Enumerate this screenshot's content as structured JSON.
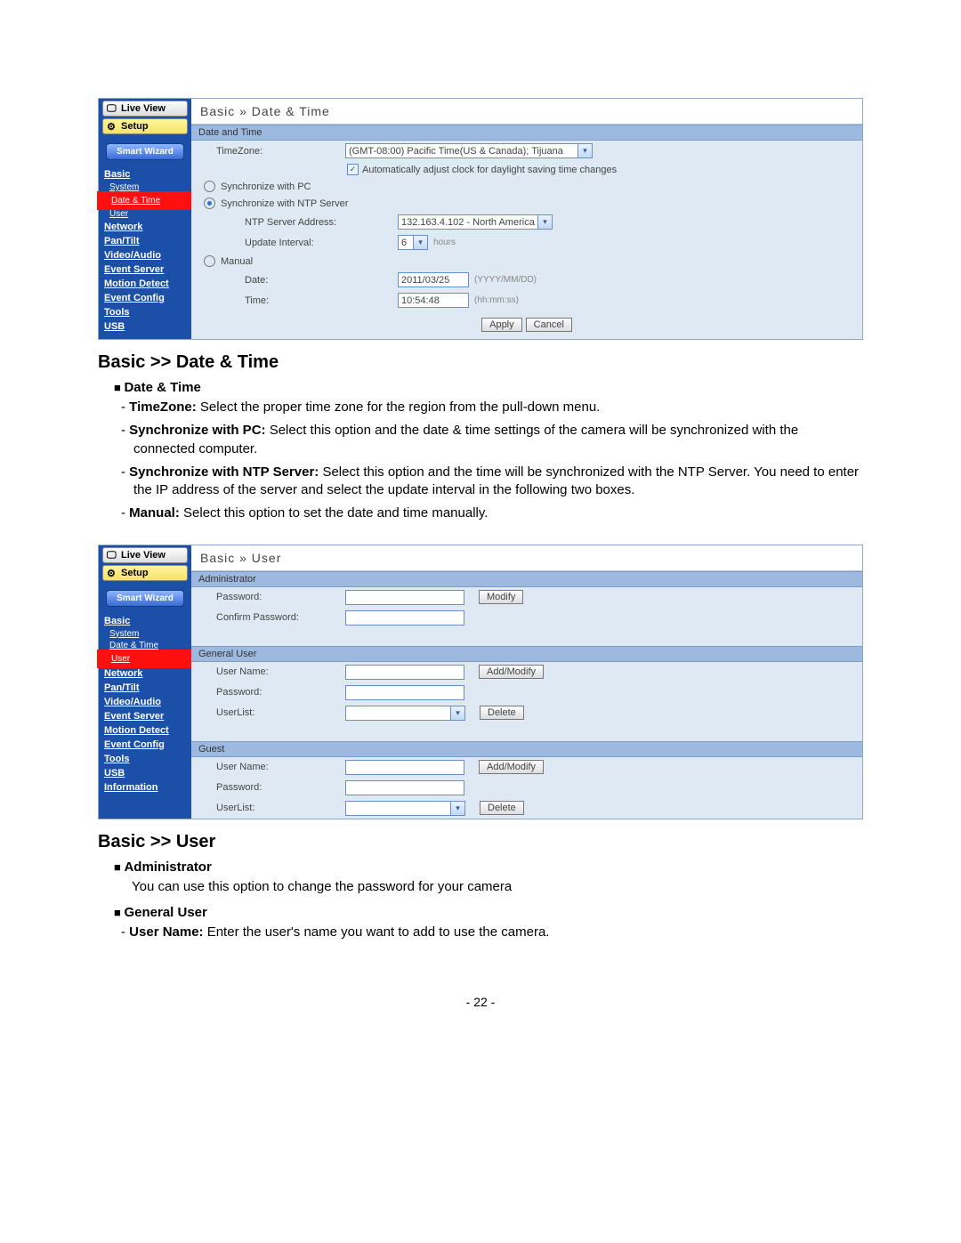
{
  "shot1": {
    "sidebar": {
      "live": "Live View",
      "setup": "Setup",
      "wizard": "Smart Wizard",
      "links": [
        "Basic",
        "System",
        "Date & Time",
        "User",
        "Network",
        "Pan/Tilt",
        "Video/Audio",
        "Event Server",
        "Motion Detect",
        "Event Config",
        "Tools",
        "USB"
      ]
    },
    "breadcrumb": "Basic » Date & Time",
    "section": "Date and Time",
    "tz_label": "TimeZone:",
    "tz_value": "(GMT-08:00) Pacific Time(US & Canada); Tijuana",
    "dst": "Automatically adjust clock for daylight saving time changes",
    "opt_pc": "Synchronize with PC",
    "opt_ntp": "Synchronize with NTP Server",
    "ntp_addr_lbl": "NTP Server Address:",
    "ntp_addr_val": "132.163.4.102 - North America",
    "upd_lbl": "Update Interval:",
    "upd_val": "6",
    "upd_unit": "hours",
    "opt_man": "Manual",
    "date_lbl": "Date:",
    "date_val": "2011/03/25",
    "date_hint": "(YYYY/MM/DD)",
    "time_lbl": "Time:",
    "time_val": "10:54:48",
    "time_hint": "(hh:mm:ss)",
    "apply": "Apply",
    "cancel": "Cancel"
  },
  "doc1": {
    "h": "Basic >> Date & Time",
    "b1": "Date & Time",
    "li1a": "TimeZone:",
    "li1b": " Select the proper time zone for the region from the pull-down menu.",
    "li2a": "Synchronize with PC:",
    "li2b": " Select this option and the date & time settings of the camera will be synchronized with the connected computer.",
    "li3a": "Synchronize with NTP Server:",
    "li3b": " Select this option and the time will be synchronized with the NTP Server. You need to enter the IP address of the server and select the update interval in the following two boxes.",
    "li4a": "Manual:",
    "li4b": " Select this option to set the date and time manually."
  },
  "shot2": {
    "sidebar": {
      "live": "Live View",
      "setup": "Setup",
      "wizard": "Smart Wizard",
      "links": [
        "Basic",
        "System",
        "Date & Time",
        "User",
        "Network",
        "Pan/Tilt",
        "Video/Audio",
        "Event Server",
        "Motion Detect",
        "Event Config",
        "Tools",
        "USB",
        "Information"
      ]
    },
    "breadcrumb": "Basic » User",
    "sec_admin": "Administrator",
    "pwd": "Password:",
    "cpwd": "Confirm Password:",
    "modify": "Modify",
    "sec_gu": "General User",
    "uname": "User Name:",
    "ulist": "UserList:",
    "addmod": "Add/Modify",
    "delete": "Delete",
    "sec_guest": "Guest"
  },
  "doc2": {
    "h": "Basic >> User",
    "b1": "Administrator",
    "p1": "You can use this option to change the password for your camera",
    "b2": "General User",
    "li1a": "User Name:",
    "li1b": " Enter the user's name you want to add to use the camera."
  },
  "page_no": "- 22 -"
}
